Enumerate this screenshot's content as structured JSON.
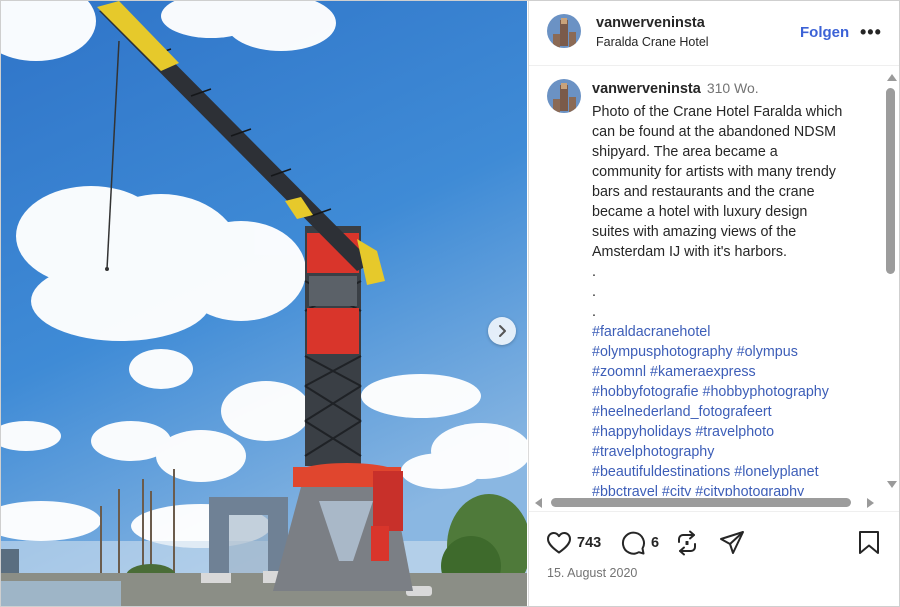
{
  "colors": {
    "link": "#3c62d6",
    "hashtag": "#3d5eb8",
    "text": "#262626",
    "muted": "#737373"
  },
  "post": {
    "username": "vanwerveninsta",
    "location": "Faralda Crane Hotel",
    "follow_label": "Folgen",
    "more_label": "•••",
    "next_icon": "chevron-right-icon"
  },
  "caption": {
    "username": "vanwerveninsta",
    "time": "310 Wo.",
    "lines": [
      "Photo of the Crane Hotel Faralda which",
      "can be found at the abandoned NDSM",
      "shipyard. The area became a",
      "community for artists with many trendy",
      "bars and restaurants and the crane",
      "became a hotel with luxury design",
      "suites with amazing views of the",
      "Amsterdam IJ with it's harbors."
    ],
    "dots": [
      ".",
      ".",
      "."
    ],
    "hashtag_lines": [
      "#faraldacranehotel",
      "#olympusphotography #olympus",
      "#zoomnl #kameraexpress",
      "#hobbyfotografie #hobbyphotography",
      "#heelnederland_fotografeert",
      "#happyholidays #travelphoto",
      "#travelphotography",
      "#beautifuldestinations #lonelyplanet",
      "#bbctravel #city #cityphotography"
    ]
  },
  "actions": {
    "likes": "743",
    "comments": "6",
    "icons": [
      "heart-icon",
      "comment-icon",
      "repost-icon",
      "share-icon",
      "bookmark-icon"
    ]
  },
  "date": "15. August 2020"
}
